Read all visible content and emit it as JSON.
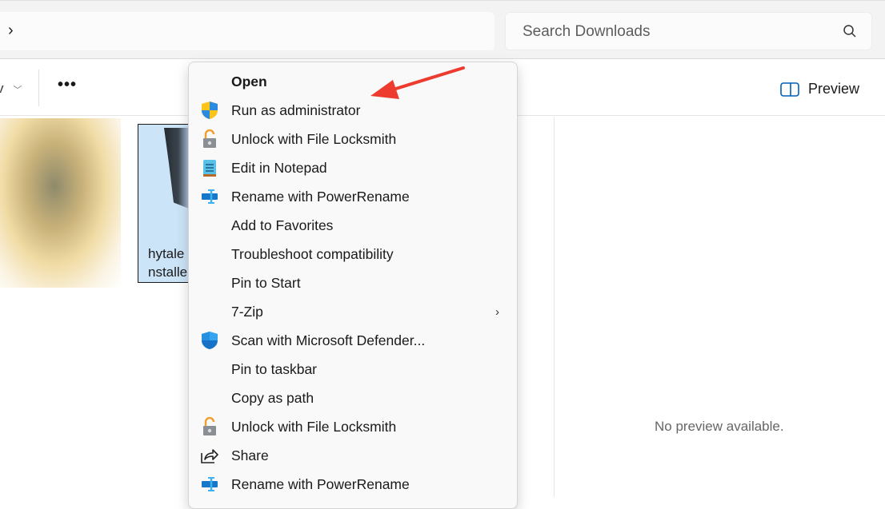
{
  "address": {
    "chevron": "›"
  },
  "search": {
    "placeholder": "Search Downloads"
  },
  "toolbar": {
    "view_partial": "v",
    "more": "•••",
    "preview_label": "Preview"
  },
  "files": [
    {
      "name_line1": "hytale",
      "name_line2": "nstalle"
    }
  ],
  "preview_pane": {
    "message": "No preview available."
  },
  "context_menu": {
    "items": [
      {
        "label": "Open",
        "icon": "none"
      },
      {
        "label": "Run as administrator",
        "icon": "uac-shield-icon"
      },
      {
        "label": "Unlock with File Locksmith",
        "icon": "lock-icon"
      },
      {
        "label": "Edit in Notepad",
        "icon": "notepad-icon"
      },
      {
        "label": "Rename with PowerRename",
        "icon": "powerrename-icon"
      },
      {
        "label": "Add to Favorites",
        "icon": "none"
      },
      {
        "label": "Troubleshoot compatibility",
        "icon": "none"
      },
      {
        "label": "Pin to Start",
        "icon": "none"
      },
      {
        "label": "7-Zip",
        "icon": "none",
        "submenu": "›"
      },
      {
        "label": "Scan with Microsoft Defender...",
        "icon": "defender-icon"
      },
      {
        "label": "Pin to taskbar",
        "icon": "none"
      },
      {
        "label": "Copy as path",
        "icon": "none"
      },
      {
        "label": "Unlock with File Locksmith",
        "icon": "lock-icon"
      },
      {
        "label": "Share",
        "icon": "share-icon"
      },
      {
        "label": "Rename with PowerRename",
        "icon": "powerrename-icon"
      }
    ]
  },
  "colors": {
    "annotation_arrow": "#ee3b2f",
    "selection": "#cce4f7"
  }
}
